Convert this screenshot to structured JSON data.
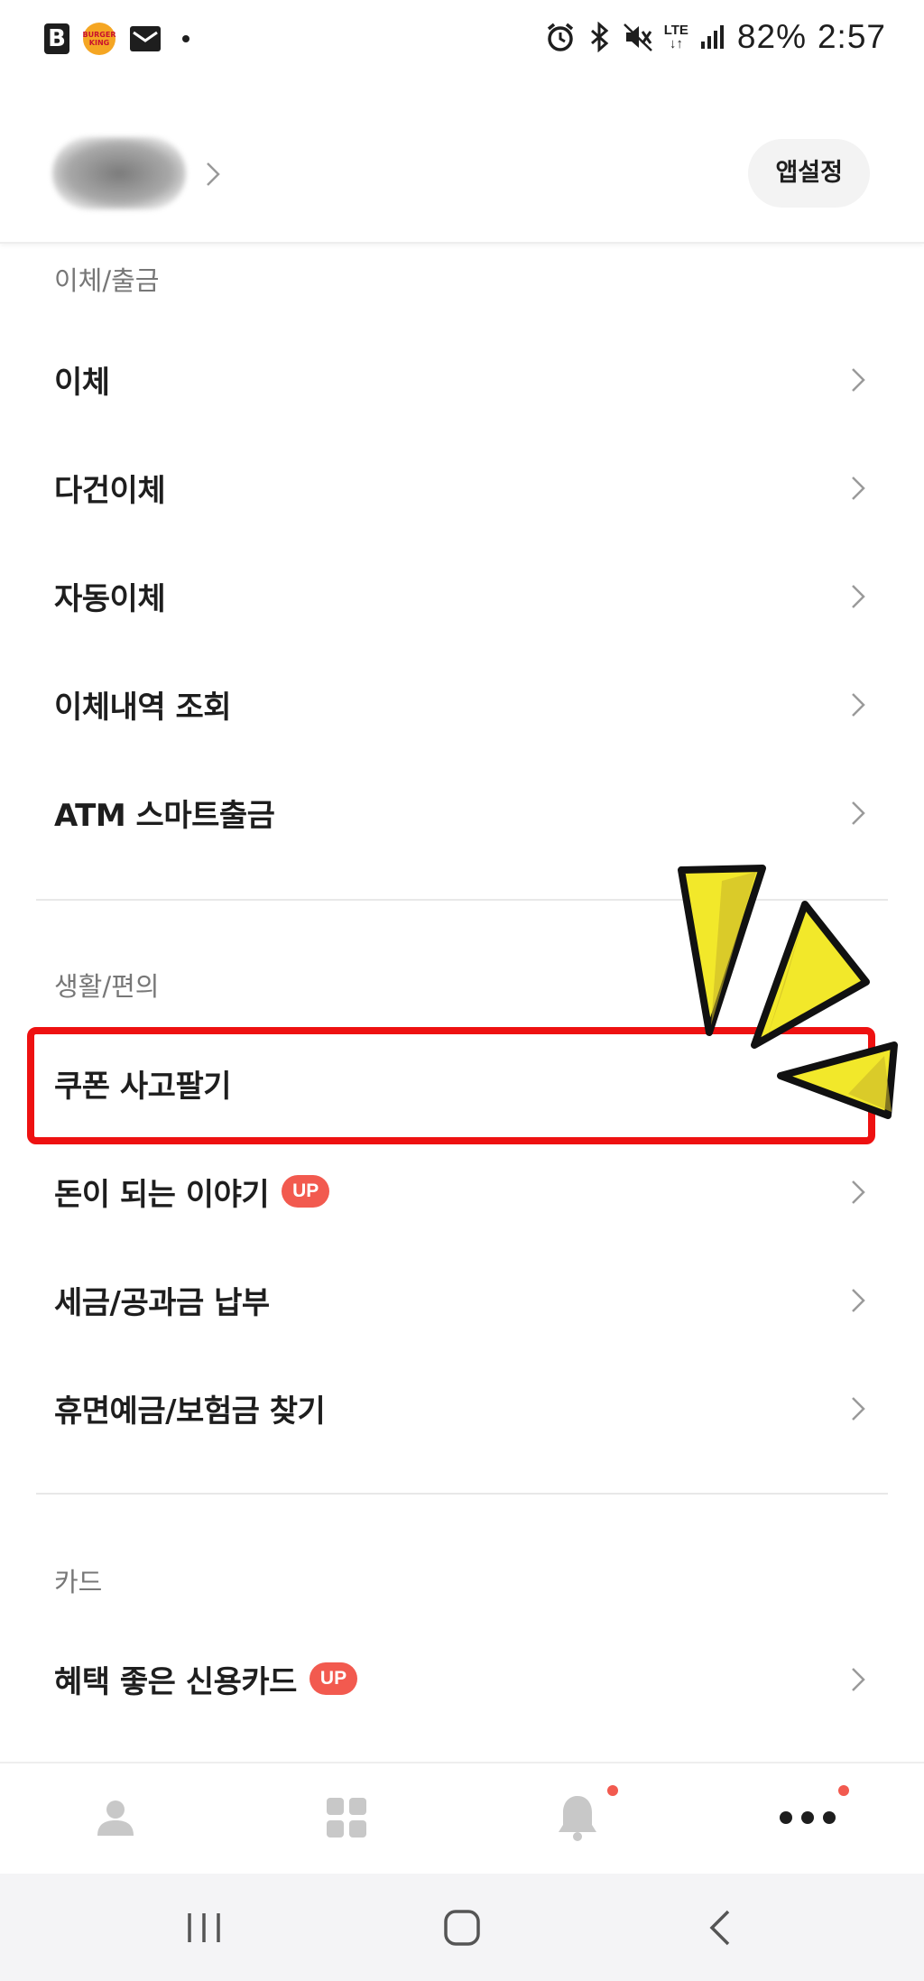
{
  "status_bar": {
    "app_b": "B",
    "bk_text": "BURGER KING",
    "network": "LTE",
    "battery": "82%",
    "time": "2:57"
  },
  "header": {
    "app_settings_label": "앱설정"
  },
  "sections": [
    {
      "label": "이체/출금",
      "items": [
        {
          "label": "이체"
        },
        {
          "label": "다건이체"
        },
        {
          "label": "자동이체"
        },
        {
          "label": "이체내역 조회"
        },
        {
          "label": "ATM 스마트출금"
        }
      ]
    },
    {
      "label": "생활/편의",
      "items": [
        {
          "label": "쿠폰 사고팔기"
        },
        {
          "label": "돈이 되는 이야기",
          "badge": "UP"
        },
        {
          "label": "세금/공과금 납부"
        },
        {
          "label": "휴면예금/보험금 찾기"
        }
      ]
    },
    {
      "label": "카드",
      "items": [
        {
          "label": "혜택 좋은 신용카드",
          "badge": "UP"
        }
      ]
    }
  ],
  "bottom_nav": [
    {
      "icon": "person-icon"
    },
    {
      "icon": "grid-icon"
    },
    {
      "icon": "bell-icon",
      "notification": true
    },
    {
      "icon": "more-icon",
      "notification": true
    }
  ],
  "colors": {
    "accent_red": "#f25a4f",
    "highlight": "#ee1111",
    "sparkle_yellow": "#f2e82a"
  }
}
